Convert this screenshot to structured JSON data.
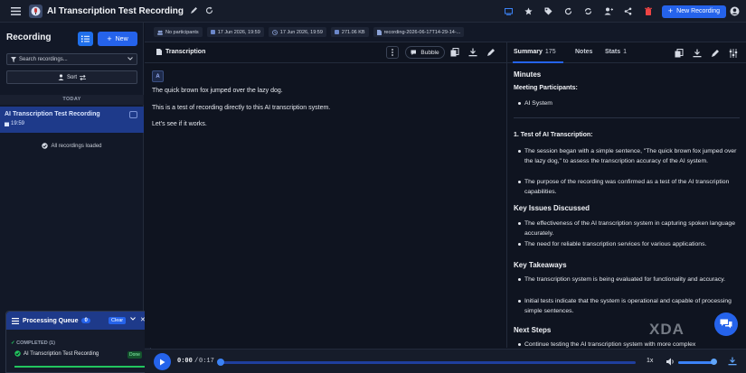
{
  "app": {
    "title": "AI Transcription Test Recording",
    "new_recording_label": "New Recording"
  },
  "sidebar": {
    "heading": "Recording",
    "new_label": "New",
    "search_placeholder": "Search recordings...",
    "sort_label": "Sort",
    "group_label": "TODAY",
    "items": [
      {
        "title": "AI Transcription Test Recording",
        "time": "19:59"
      }
    ],
    "status": "All recordings loaded"
  },
  "queue": {
    "title": "Processing Queue",
    "count": "0",
    "clear_label": "Clear",
    "completed_label": "COMPLETED (1)",
    "items": [
      {
        "name": "AI Transcription Test Recording",
        "status": "Done"
      }
    ]
  },
  "meta": {
    "participants": "No participants",
    "date1": "17 Jun 2026, 19:59",
    "date2": "17 Jun 2026, 19:59",
    "size": "271.06 KB",
    "filename": "recording-2026-06-17T14-29-14-..."
  },
  "transcription": {
    "title": "Transcription",
    "bubble_label": "Bubble",
    "speaker": "A",
    "lines": [
      "The quick brown fox jumped over the lazy dog.",
      "This is a test of recording directly to this AI transcription system.",
      "Let's see if it works."
    ]
  },
  "summary_tabs": {
    "summary_label": "Summary",
    "summary_count": "175",
    "notes_label": "Notes",
    "stats_label": "Stats",
    "stats_count": "1"
  },
  "summary": {
    "h_minutes": "Minutes",
    "participants_label": "Meeting Participants:",
    "participants": [
      "AI System"
    ],
    "section1": "1. Test of AI Transcription:",
    "section1_items": [
      "The session began with a simple sentence, \"The quick brown fox jumped over the lazy dog,\" to assess the transcription accuracy of the AI system.",
      "The purpose of the recording was confirmed as a test of the AI transcription capabilities."
    ],
    "h_issues": "Key Issues Discussed",
    "issues": [
      "The effectiveness of the AI transcription system in capturing spoken language accurately.",
      "The need for reliable transcription services for various applications."
    ],
    "h_takeaways": "Key Takeaways",
    "takeaways": [
      "The transcription system is being evaluated for functionality and accuracy.",
      "Initial tests indicate that the system is operational and capable of processing simple sentences."
    ],
    "h_next": "Next Steps",
    "next": [
      "Continue testing the AI transcription system with more complex"
    ]
  },
  "player": {
    "current": "0:00",
    "separator": "/",
    "duration": "0:17",
    "speed": "1x",
    "progress": 0.0,
    "volume": 0.9
  },
  "watermark": "XDA",
  "colors": {
    "accent": "#2563eb",
    "selected": "#1e3a8a",
    "delete": "#ef4444",
    "done": "#22c55e"
  }
}
